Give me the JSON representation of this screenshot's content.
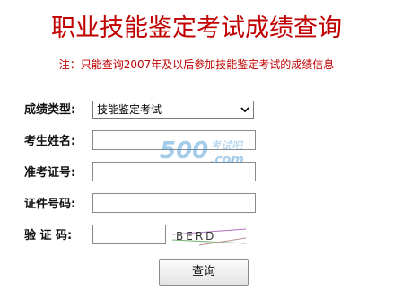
{
  "page": {
    "title": "职业技能鉴定考试成绩查询",
    "note": "注：只能查询2007年及以后参加技能鉴定考试的成绩信息"
  },
  "form": {
    "type_label": "成绩类型:",
    "type_selected": "技能鉴定考试",
    "name_label": "考生姓名:",
    "name_value": "",
    "ticket_label": "准考证号:",
    "ticket_value": "",
    "cert_label": "证件号码:",
    "cert_value": "",
    "code_label": "验 证 码:",
    "code_value": "",
    "captcha_text": "BERD",
    "submit_label": "查询"
  },
  "watermark": {
    "number": "500",
    "brand": "考试吧",
    "domain": ".com"
  },
  "colors": {
    "title": "#c00000",
    "note": "#c00000",
    "watermark": "#3a8fd0"
  }
}
